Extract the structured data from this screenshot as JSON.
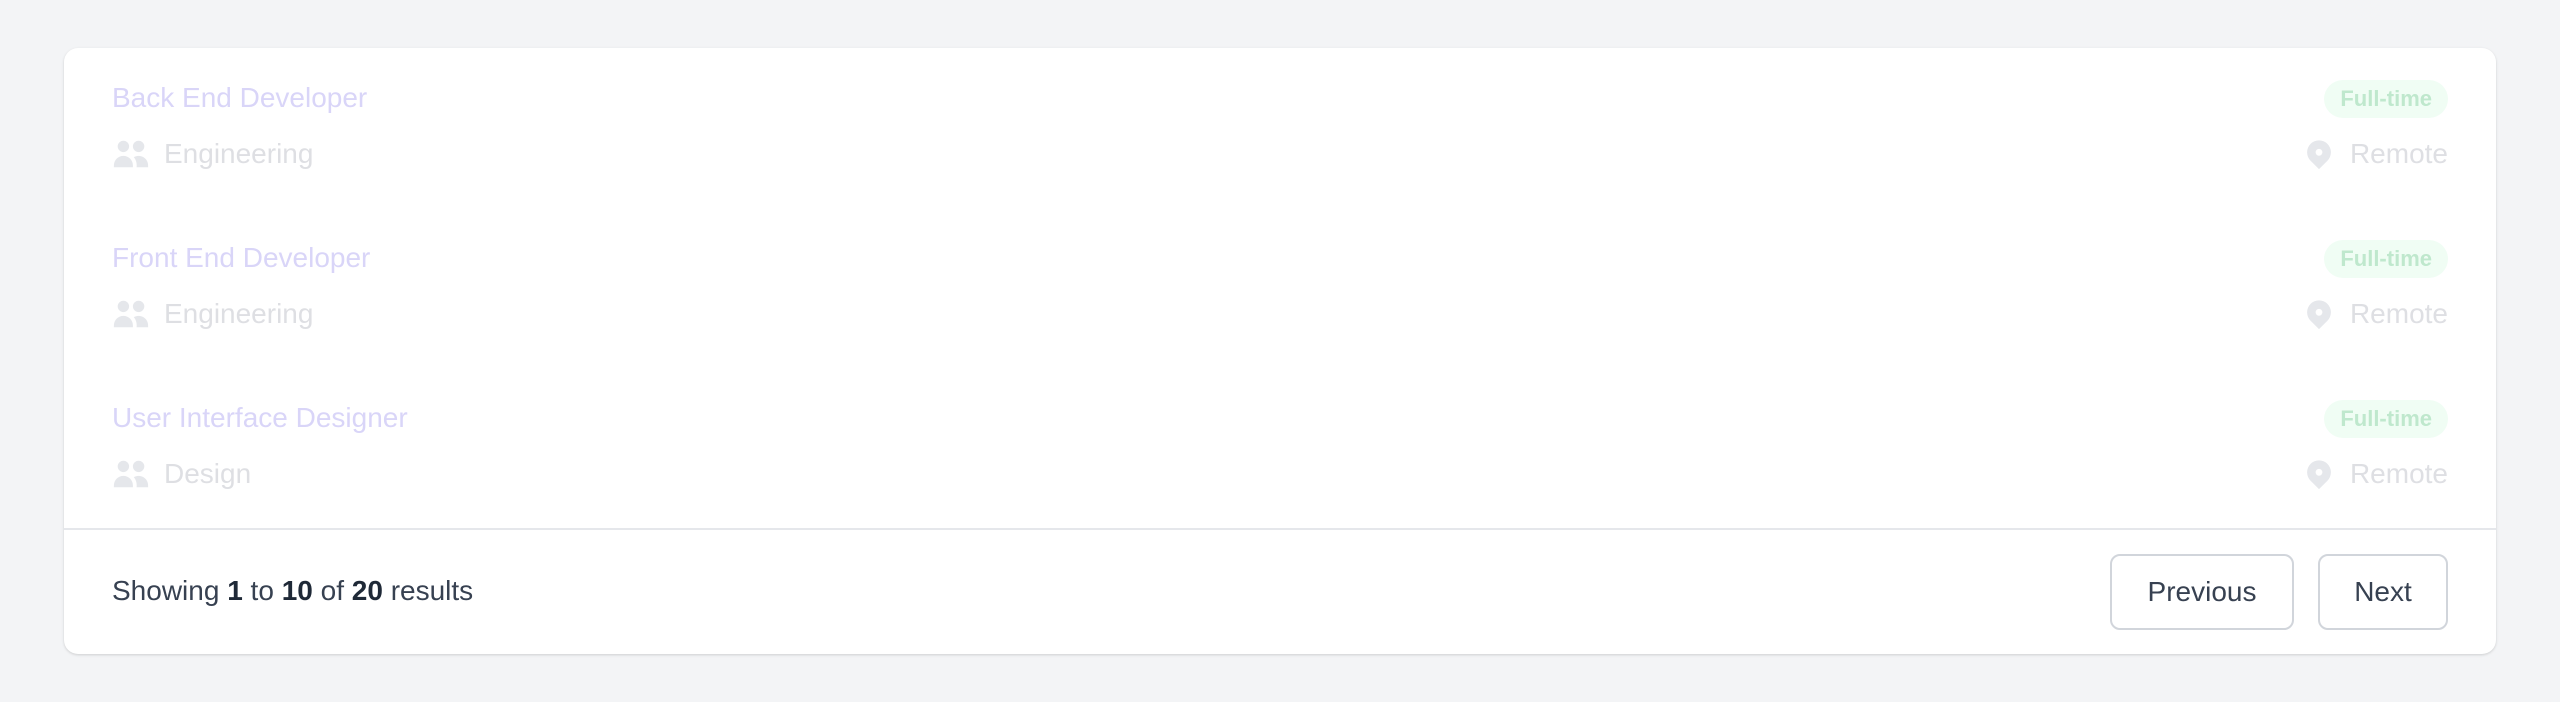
{
  "jobs": [
    {
      "title": "Back End Developer",
      "type": "Full-time",
      "department": "Engineering",
      "location": "Remote"
    },
    {
      "title": "Front End Developer",
      "type": "Full-time",
      "department": "Engineering",
      "location": "Remote"
    },
    {
      "title": "User Interface Designer",
      "type": "Full-time",
      "department": "Design",
      "location": "Remote"
    }
  ],
  "pagination": {
    "prefix": "Showing",
    "from": "1",
    "to_word": "to",
    "to": "10",
    "of_word": "of",
    "total": "20",
    "suffix": "results",
    "previous_label": "Previous",
    "next_label": "Next"
  },
  "icons": {
    "department": "users-icon",
    "location": "location-pin-icon"
  },
  "colors": {
    "title": "#d9d5f8",
    "badge_bg": "#f0fdf4",
    "badge_text": "#bfe8cd",
    "meta_text": "#dedfe3",
    "summary_text": "#374151"
  }
}
